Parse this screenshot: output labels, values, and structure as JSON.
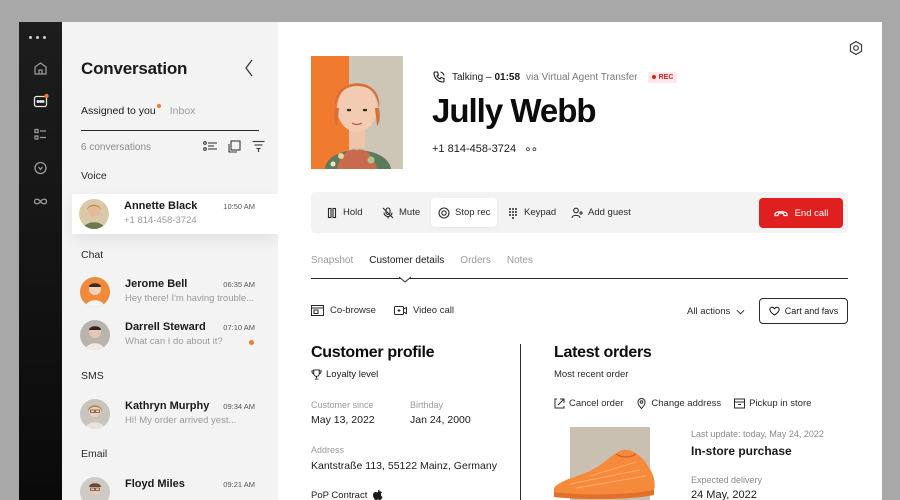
{
  "rail": {
    "icons": [
      "menu-dots-icon",
      "home-icon",
      "chat-icon",
      "list-icon",
      "bulb-icon",
      "infinity-icon"
    ]
  },
  "conversation": {
    "title": "Conversation",
    "tabs": {
      "assigned": "Assigned to you",
      "inbox": "Inbox"
    },
    "count": "6 conversations",
    "groups": {
      "voice": "Voice",
      "chat": "Chat",
      "sms": "SMS",
      "email": "Email"
    },
    "items": [
      {
        "name": "Annette Black",
        "time": "10:50 AM",
        "preview": "+1 814-458-3724",
        "unread": false
      },
      {
        "name": "Jerome Bell",
        "time": "06:35 AM",
        "preview": "Hey there! I'm having trouble...",
        "unread": false
      },
      {
        "name": "Darrell Steward",
        "time": "07:10 AM",
        "preview": "What can I do about it?",
        "unread": true
      },
      {
        "name": "Kathryn Murphy",
        "time": "09:34 AM",
        "preview": "Hi! My order arrived yest...",
        "unread": false
      },
      {
        "name": "Floyd Miles",
        "time": "09:21 AM",
        "preview": "",
        "unread": false
      }
    ]
  },
  "call": {
    "status": "Talking –",
    "duration": "01:58",
    "via": "via Virtual Agent Transfer",
    "rec": "REC",
    "name": "Jully Webb",
    "phone": "+1 814-458-3724",
    "phone_more": "∘∘"
  },
  "toolbar": {
    "hold": "Hold",
    "mute": "Mute",
    "stop_rec": "Stop rec",
    "keypad": "Keypad",
    "add_guest": "Add guest",
    "end_call": "End call"
  },
  "tabs": [
    "Snapshot",
    "Customer details",
    "Orders",
    "Notes"
  ],
  "actions": {
    "cobrowse": "Co-browse",
    "video": "Video call",
    "all": "All actions",
    "cart": "Cart and favs"
  },
  "profile": {
    "title": "Customer profile",
    "loyalty": "Loyalty level",
    "since_label": "Customer since",
    "since": "May 13, 2022",
    "birthday_label": "Birthday",
    "birthday": "Jan 24, 2000",
    "address_label": "Address",
    "address": "Kantstraße 113, 55122 Mainz, Germany",
    "contract": "PoP Contract"
  },
  "orders": {
    "title": "Latest orders",
    "subtitle": "Most recent order",
    "cancel": "Cancel order",
    "change_address": "Change address",
    "pickup": "Pickup in store",
    "last_update": "Last update: today, May 24, 2022",
    "type": "In-store purchase",
    "expected_label": "Expected delivery",
    "expected": "24 May, 2022"
  },
  "colors": {
    "accent": "#f07a2d",
    "danger": "#e01f1f",
    "rail": "#111111"
  }
}
